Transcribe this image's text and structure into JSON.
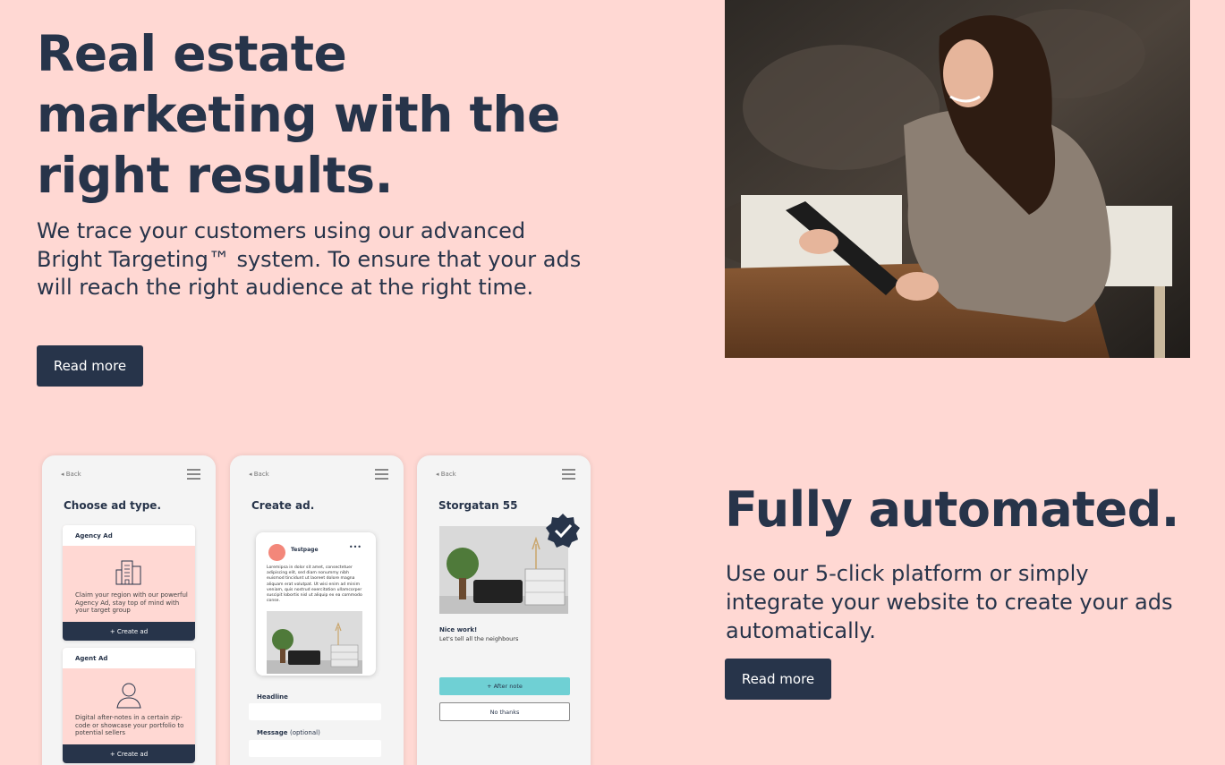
{
  "hero": {
    "title": "Real estate marketing with the right results.",
    "subtitle": "We trace your customers using our advanced Bright Targeting™ system. To ensure that your ads will reach the right audience at the right time.",
    "button": "Read more"
  },
  "automated": {
    "title": "Fully automated.",
    "subtitle": "Use our 5-click platform or simply integrate your website to create your ads automatically.",
    "button": "Read more"
  },
  "phones": {
    "choose": {
      "back": "◂ Back",
      "title": "Choose ad type.",
      "cards": [
        {
          "heading": "Agency Ad",
          "description": "Claim your region with our powerful Agency Ad, stay top of mind with your target group",
          "button": "+ Create ad",
          "icon": "building-icon"
        },
        {
          "heading": "Agent Ad",
          "description": "Digital after-notes in a certain zip-code or showcase your portfolio to potential sellers",
          "button": "+ Create ad",
          "icon": "person-icon"
        }
      ]
    },
    "create": {
      "back": "◂ Back",
      "title": "Create ad.",
      "post_name": "Testpage",
      "post_menu": "•••",
      "post_text": "Loremipsa in dolor sit amet, consectetuer adipiscing elit, sed diam nonummy nibh euismod tincidunt ut laoreet dolore magna aliquam erat volutpat. Ut wisi enim ad minim veniam, quis nostrud exercitation ullamcorper suscipit lobortis nisl ut aliquip ex ea commodo conse.",
      "headline_label": "Headline",
      "message_label": "Message",
      "message_optional": "(optional)"
    },
    "listing": {
      "back": "◂ Back",
      "title": "Storgatan 55",
      "nice": "Nice work!",
      "neighbours": "Let's tell all the neighbours",
      "after_button": "+ After note",
      "no_button": "No thanks"
    }
  },
  "colors": {
    "background": "#ffd8d3",
    "navy": "#27344a",
    "teal": "#6fd0d4",
    "coral": "#f3877a"
  }
}
